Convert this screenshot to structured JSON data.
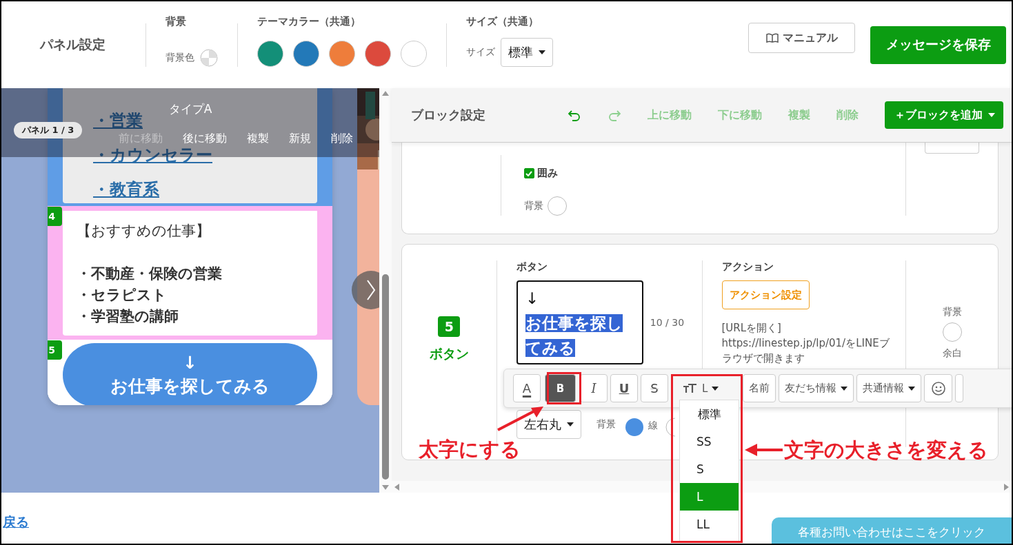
{
  "header": {
    "title": "パネル設定",
    "background": {
      "heading": "背景",
      "label": "背景色"
    },
    "theme_colors": {
      "heading": "テーマカラー（共通）",
      "swatches": [
        {
          "color": "#138f78"
        },
        {
          "color": "#2379b8"
        },
        {
          "color": "#ee7d3b"
        },
        {
          "color": "#dc4a3d"
        },
        {
          "color": "#ffffff"
        }
      ]
    },
    "size": {
      "heading": "サイズ（共通）",
      "label": "サイズ",
      "value": "標準"
    },
    "manual_button": "マニュアル",
    "save_button": "メッセージを保存"
  },
  "preview": {
    "overlay": {
      "title": "タイプA",
      "panel_label": "パネル 1 / 3",
      "actions": [
        {
          "label": "前に移動",
          "disabled": true
        },
        {
          "label": "後に移動",
          "disabled": false
        },
        {
          "label": "複製",
          "disabled": false
        },
        {
          "label": "新規",
          "disabled": false
        },
        {
          "label": "削除",
          "disabled": false
        }
      ]
    },
    "link_list": [
      "・営業",
      "・カウンセラー",
      "・教育系"
    ],
    "text_block": {
      "number": "4",
      "heading": "【おすすめの仕事】",
      "items": [
        "・不動産・保険の営業",
        "・セラピスト",
        "・学習塾の講師"
      ]
    },
    "button_block": {
      "number": "5",
      "arrow": "↓",
      "label": "お仕事を探してみる"
    }
  },
  "block_settings": {
    "title": "ブロック設定",
    "history": [
      {
        "kind": "undo",
        "disabled": false
      },
      {
        "kind": "redo",
        "disabled": true
      }
    ],
    "actions": [
      "上に移動",
      "下に移動",
      "複製",
      "削除"
    ],
    "add_button": "＋ブロックを追加",
    "frame_block": {
      "frame_checkbox": {
        "label": "囲み",
        "checked": true
      },
      "background_label": "背景"
    },
    "button_block": {
      "number": "5",
      "type_label": "ボタン",
      "text_heading": "ボタン",
      "text_arrow": "↓",
      "text_selected": "お仕事を探してみる",
      "counter": "10 / 30",
      "action_heading": "アクション",
      "action_button": "アクション設定",
      "action_description": "[URLを開く] https://linestep.jp/lp/01/をLINEブラウザで開きます",
      "background_label": "背景",
      "margin_label": "余白",
      "shape_select": "左右丸",
      "shape_background_label": "背景",
      "shape_line_label": "線"
    }
  },
  "format_toolbar": [
    {
      "kind": "color",
      "label": "A",
      "selected": false
    },
    {
      "kind": "bold",
      "label": "B",
      "selected": true
    },
    {
      "kind": "italic",
      "label": "I",
      "selected": false
    },
    {
      "kind": "underline",
      "label": "U",
      "selected": false
    },
    {
      "kind": "strike",
      "label": "S",
      "selected": false
    },
    {
      "kind": "size",
      "label": "L",
      "selected": false
    },
    {
      "kind": "menu",
      "label": "名前",
      "selected": false
    },
    {
      "kind": "dropdown",
      "label": "友だち情報",
      "selected": false
    },
    {
      "kind": "dropdown",
      "label": "共通情報",
      "selected": false
    },
    {
      "kind": "emoji",
      "selected": false
    }
  ],
  "size_menu": [
    {
      "label": "標準",
      "selected": false
    },
    {
      "label": "SS",
      "selected": false
    },
    {
      "label": "S",
      "selected": false
    },
    {
      "label": "L",
      "selected": true
    },
    {
      "label": "LL",
      "selected": false
    }
  ],
  "annotations": [
    {
      "text": "太字にする"
    },
    {
      "text": "文字の大きさを変える"
    }
  ],
  "footer": {
    "back_link": "戻る",
    "contact_tab": "各種お問い合わせはここをクリック"
  }
}
